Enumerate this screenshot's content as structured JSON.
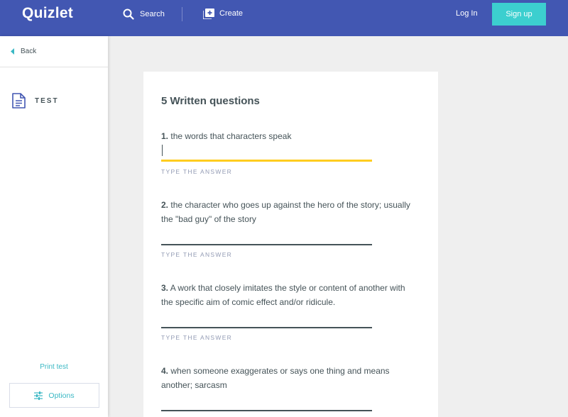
{
  "header": {
    "logo": "Quizlet",
    "search_label": "Search",
    "create_label": "Create",
    "login_label": "Log In",
    "signup_label": "Sign up"
  },
  "sidebar": {
    "back_label": "Back",
    "mode_label": "TEST",
    "print_label": "Print test",
    "options_label": "Options"
  },
  "main": {
    "title": "5 Written questions",
    "answer_hint": "TYPE THE ANSWER",
    "questions": [
      {
        "number": "1.",
        "text": "the words that characters speak",
        "answer": ""
      },
      {
        "number": "2.",
        "text": "the character who goes up against the hero of the story; usually the \"bad guy\" of the story",
        "answer": ""
      },
      {
        "number": "3.",
        "text": "A work that closely imitates the style or content of another with the specific aim of comic effect and/or ridicule.",
        "answer": ""
      },
      {
        "number": "4.",
        "text": "when someone exaggerates or says one thing and means another; sarcasm",
        "answer": ""
      }
    ]
  },
  "colors": {
    "header_bg": "#4257b2",
    "signup_bg": "#3ccfcf",
    "accent_teal": "#3ab8c4",
    "active_underline": "#ffcd1f",
    "text": "#455358"
  },
  "icons": {
    "search": "search-icon",
    "create": "create-plus-icon",
    "back": "back-caret-icon",
    "test": "document-icon",
    "options": "sliders-icon"
  }
}
